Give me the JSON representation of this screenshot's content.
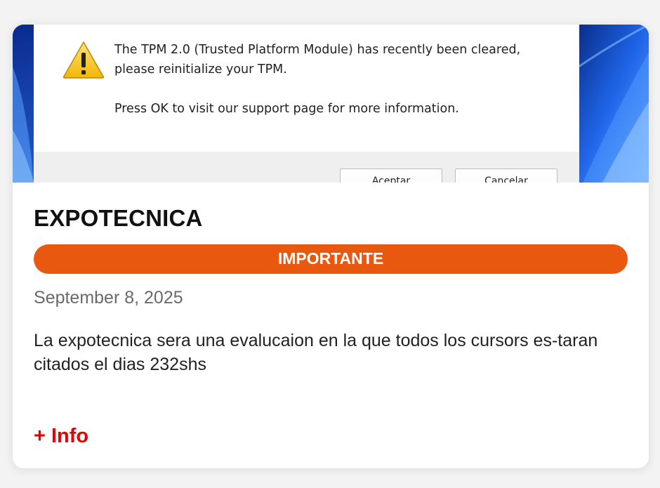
{
  "dialog": {
    "message_line1": "The TPM 2.0 (Trusted Platform Module) has recently been cleared,",
    "message_line2": "please reinitialize your TPM.",
    "message_line3": "Press OK to visit our support page for more information.",
    "ok_label": "Aceptar",
    "cancel_label": "Cancelar",
    "icon": "warning-icon"
  },
  "card": {
    "title": "EXPOTECNICA",
    "badge": "IMPORTANTE",
    "date": "September 8, 2025",
    "description": "La expotecnica sera una evalucaion en la que todos los cursors es-taran citados el dias 232shs",
    "more_label": "+ Info"
  },
  "colors": {
    "badge_bg": "#e8580f",
    "more_link": "#e60000",
    "wallpaper": "#1d5fd6"
  }
}
